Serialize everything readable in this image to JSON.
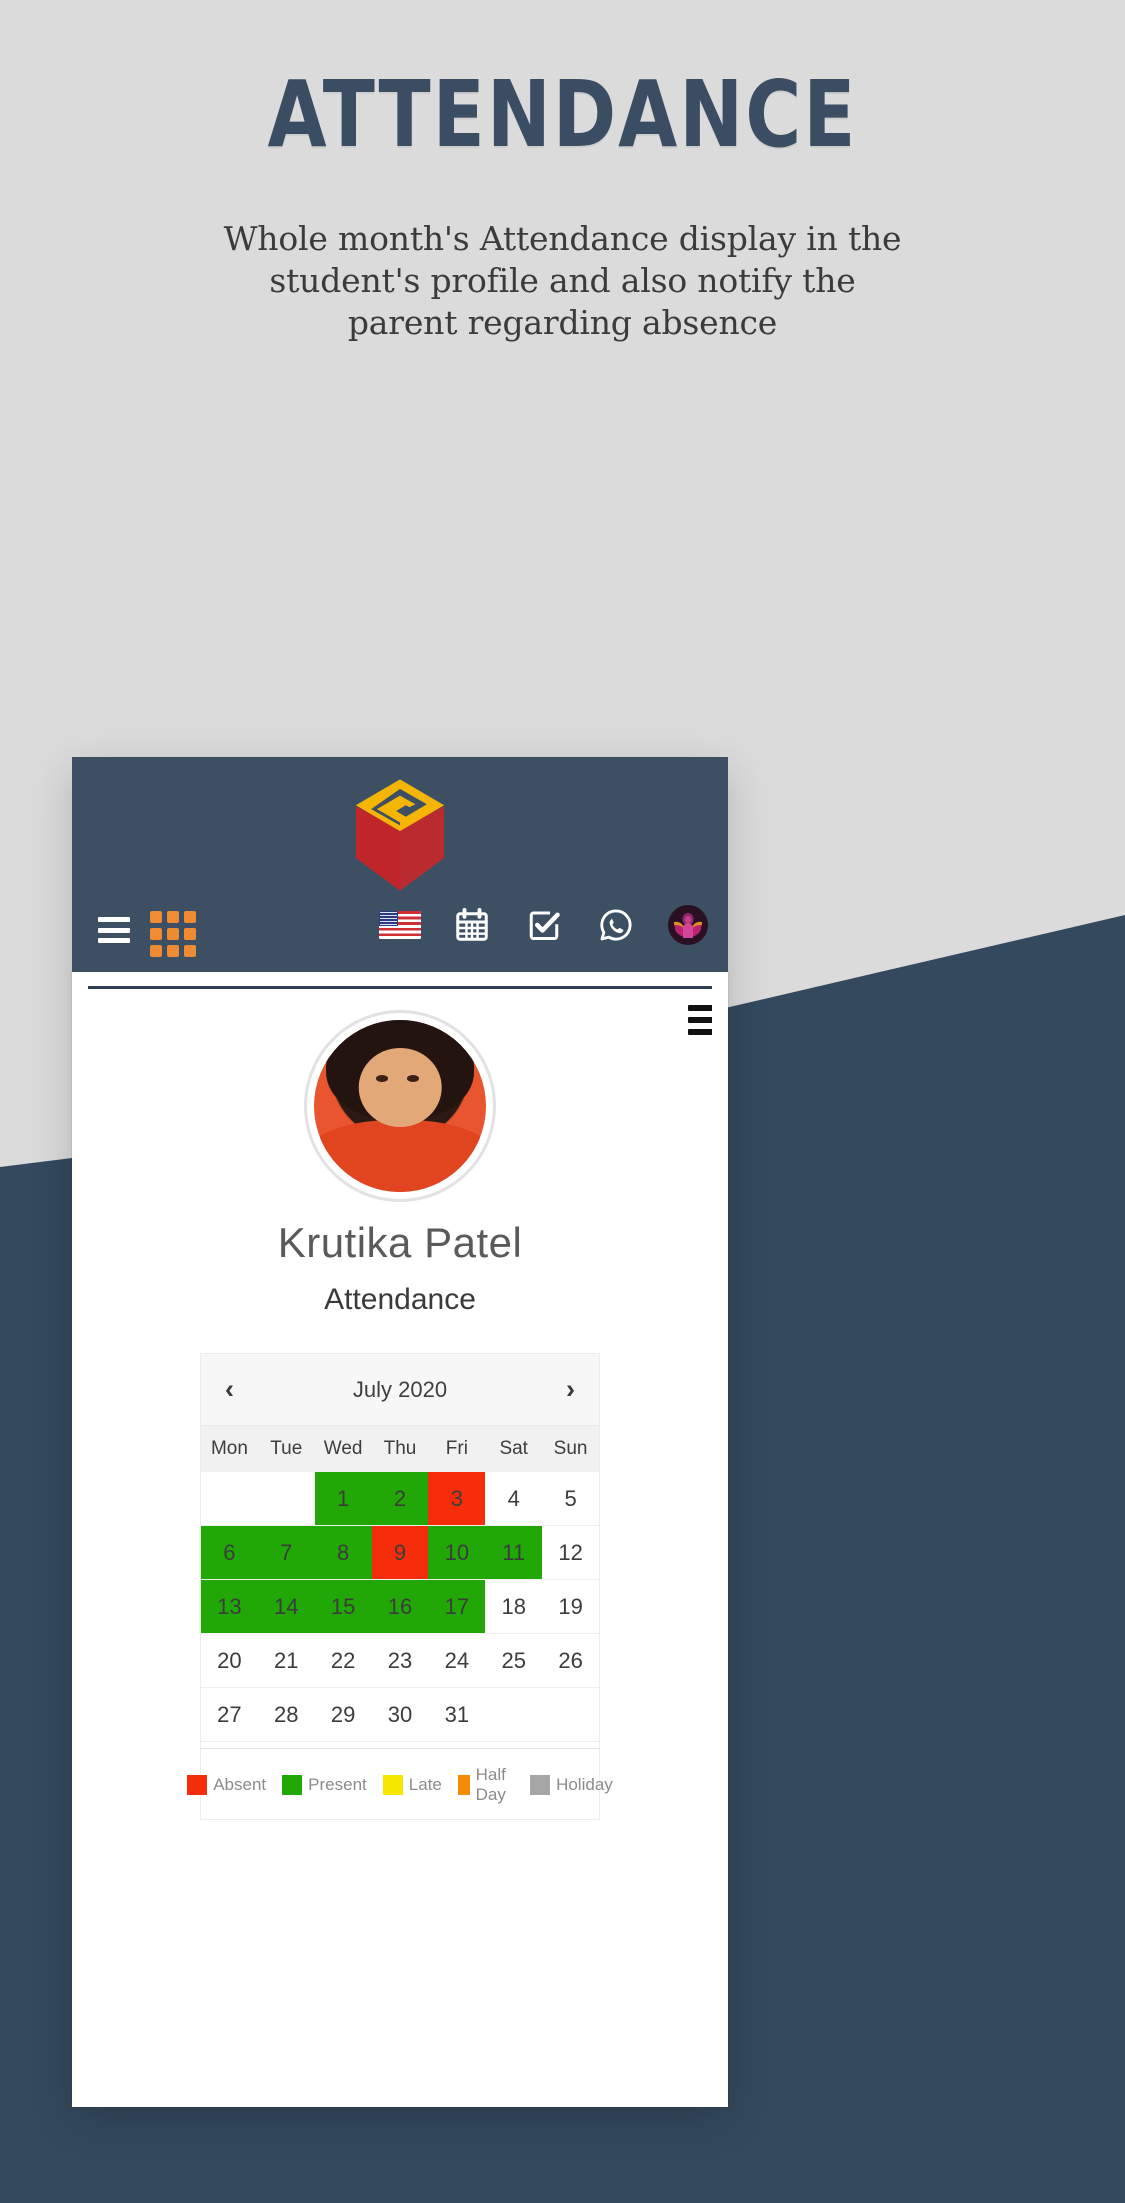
{
  "page": {
    "headline": "ATTENDANCE",
    "subtitle": "Whole month's Attendance display in the student's profile and also notify the parent regarding absence",
    "background_color": "#dcdbdb",
    "accent_navy": "#34495e"
  },
  "app_header": {
    "menu_icon": "hamburger-icon",
    "grid_icon": "apps-grid-icon",
    "grid_color": "#ef8b33",
    "logo": "cube-logo",
    "logo_colors": {
      "top": "#f5b505",
      "body": "#c0252a"
    },
    "icons": [
      {
        "name": "us-flag-icon",
        "label": "English (US)"
      },
      {
        "name": "calendar-icon",
        "label": "Calendar"
      },
      {
        "name": "checkbox-icon",
        "label": "Tasks"
      },
      {
        "name": "whatsapp-icon",
        "label": "WhatsApp"
      },
      {
        "name": "lotus-avatar-icon",
        "label": "Profile"
      }
    ],
    "bar_color": "#3d4f63"
  },
  "profile": {
    "student_name": "Krutika Patel",
    "section_label": "Attendance",
    "avatar_alt": "student-photo"
  },
  "calendar": {
    "prev_label": "‹",
    "next_label": "›",
    "month_title": "July 2020",
    "weekdays": [
      "Mon",
      "Tue",
      "Wed",
      "Thu",
      "Fri",
      "Sat",
      "Sun"
    ],
    "cells": [
      {
        "day": "",
        "status": "empty"
      },
      {
        "day": "",
        "status": "empty"
      },
      {
        "day": "1",
        "status": "present"
      },
      {
        "day": "2",
        "status": "present"
      },
      {
        "day": "3",
        "status": "absent"
      },
      {
        "day": "4",
        "status": "none"
      },
      {
        "day": "5",
        "status": "none"
      },
      {
        "day": "6",
        "status": "present"
      },
      {
        "day": "7",
        "status": "present"
      },
      {
        "day": "8",
        "status": "present"
      },
      {
        "day": "9",
        "status": "absent"
      },
      {
        "day": "10",
        "status": "present"
      },
      {
        "day": "11",
        "status": "present"
      },
      {
        "day": "12",
        "status": "none"
      },
      {
        "day": "13",
        "status": "present"
      },
      {
        "day": "14",
        "status": "present"
      },
      {
        "day": "15",
        "status": "present"
      },
      {
        "day": "16",
        "status": "present"
      },
      {
        "day": "17",
        "status": "present"
      },
      {
        "day": "18",
        "status": "none"
      },
      {
        "day": "19",
        "status": "none"
      },
      {
        "day": "20",
        "status": "none"
      },
      {
        "day": "21",
        "status": "none"
      },
      {
        "day": "22",
        "status": "none"
      },
      {
        "day": "23",
        "status": "none"
      },
      {
        "day": "24",
        "status": "none"
      },
      {
        "day": "25",
        "status": "none"
      },
      {
        "day": "26",
        "status": "none"
      },
      {
        "day": "27",
        "status": "none"
      },
      {
        "day": "28",
        "status": "none"
      },
      {
        "day": "29",
        "status": "none"
      },
      {
        "day": "30",
        "status": "none"
      },
      {
        "day": "31",
        "status": "none"
      },
      {
        "day": "",
        "status": "empty"
      },
      {
        "day": "",
        "status": "empty"
      }
    ],
    "legend": [
      {
        "label": "Absent",
        "color": "#f52d0a"
      },
      {
        "label": "Present",
        "color": "#22a806"
      },
      {
        "label": "Late",
        "color": "#f7e600"
      },
      {
        "label": "Half Day",
        "color": "#f58b00"
      },
      {
        "label": "Holiday",
        "color": "#a6a6a6"
      }
    ]
  }
}
